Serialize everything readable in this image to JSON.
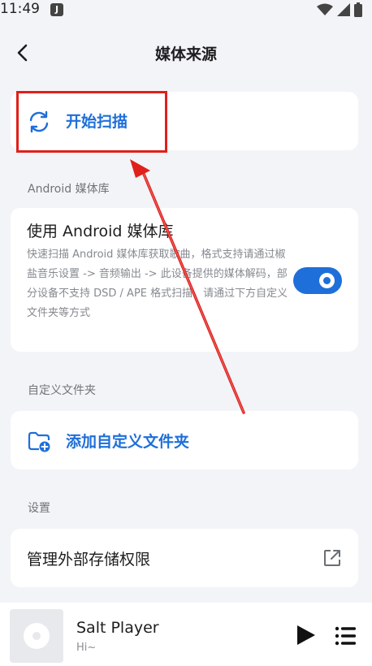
{
  "status_bar": {
    "time": "11:49",
    "notification_letter": "J"
  },
  "header": {
    "title": "媒体来源"
  },
  "scan": {
    "label": "开始扫描"
  },
  "android_section": {
    "heading": "Android 媒体库",
    "title": "使用 Android 媒体库",
    "description": "快速扫描 Android 媒体库获取歌曲，格式支持请通过椒盐音乐设置 -> 音频输出 -> 此设备提供的媒体解码，部分设备不支持 DSD / APE 格式扫描，请通过下方自定义文件夹等方式",
    "enabled": true
  },
  "custom_folder_section": {
    "heading": "自定义文件夹",
    "add_label": "添加自定义文件夹"
  },
  "settings_section": {
    "heading": "设置",
    "storage_label": "管理外部存储权限"
  },
  "player": {
    "title": "Salt Player",
    "artist": "Hi~"
  },
  "colors": {
    "accent": "#1e6fd9",
    "annotation": "#e0201b",
    "background": "#f3f4f7"
  },
  "icons": [
    "back-arrow-icon",
    "sync-icon",
    "folder-add-icon",
    "external-link-icon",
    "play-icon",
    "queue-list-icon",
    "wifi-icon",
    "signal-icon",
    "battery-icon"
  ]
}
